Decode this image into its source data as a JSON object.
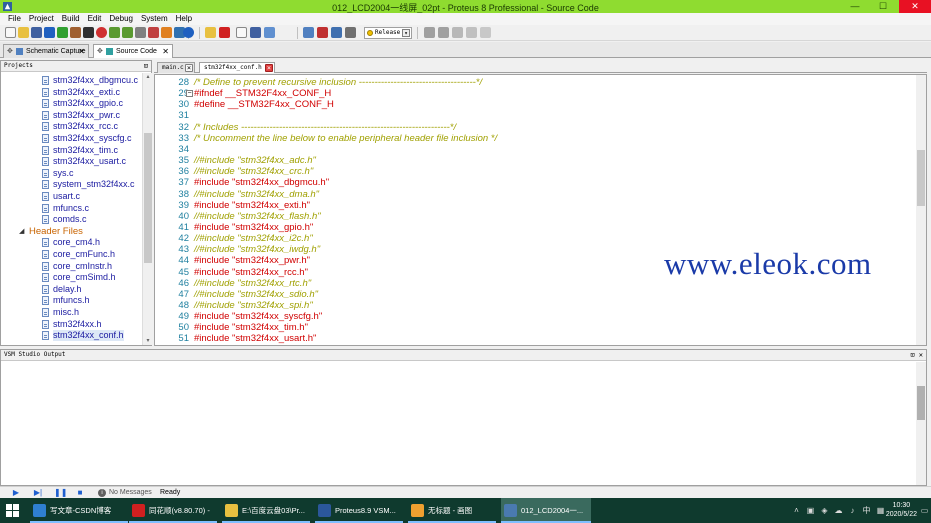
{
  "window": {
    "title": "012_LCD2004一线屏_02pt - Proteus 8 Professional - Source Code",
    "minimize": "—",
    "maximize": "☐",
    "close": "✕"
  },
  "menu": [
    "File",
    "Project",
    "Build",
    "Edit",
    "Debug",
    "System",
    "Help"
  ],
  "toolbar": {
    "build_config": "Release"
  },
  "main_tabs": [
    {
      "label": "Schematic Capture",
      "active": false
    },
    {
      "label": "Source Code",
      "active": true
    }
  ],
  "projects_panel": {
    "title": "Projects",
    "source_files": [
      "stm32f4xx_dbgmcu.c",
      "stm32f4xx_exti.c",
      "stm32f4xx_gpio.c",
      "stm32f4xx_pwr.c",
      "stm32f4xx_rcc.c",
      "stm32f4xx_syscfg.c",
      "stm32f4xx_tim.c",
      "stm32f4xx_usart.c",
      "sys.c",
      "system_stm32f4xx.c",
      "usart.c",
      "mfuncs.c",
      "comds.c"
    ],
    "header_folder": "Header Files",
    "header_files": [
      "core_cm4.h",
      "core_cmFunc.h",
      "core_cmInstr.h",
      "core_cmSimd.h",
      "delay.h",
      "mfuncs.h",
      "misc.h",
      "stm32f4xx.h",
      "stm32f4xx_conf.h"
    ]
  },
  "editor_tabs": [
    {
      "label": "main.c",
      "active": false
    },
    {
      "label": "stm32f4xx_conf.h",
      "active": true
    }
  ],
  "code_lines": [
    {
      "n": "28",
      "text": "/* Define to prevent recursive inclusion -------------------------------------*/",
      "kind": "com",
      "fold": ""
    },
    {
      "n": "29",
      "text": "#ifndef __STM32F4xx_CONF_H",
      "kind": "pp",
      "fold": "−"
    },
    {
      "n": "30",
      "text": "#define __STM32F4xx_CONF_H",
      "kind": "pp",
      "fold": ""
    },
    {
      "n": "31",
      "text": "",
      "kind": "com",
      "fold": ""
    },
    {
      "n": "32",
      "text": "/* Includes ------------------------------------------------------------------*/",
      "kind": "com",
      "fold": ""
    },
    {
      "n": "33",
      "text": "/* Uncomment the line below to enable peripheral header file inclusion */",
      "kind": "com",
      "fold": ""
    },
    {
      "n": "34",
      "text": "",
      "kind": "com",
      "fold": ""
    },
    {
      "n": "35",
      "text": "//#include \"stm32f4xx_adc.h\"",
      "kind": "com",
      "fold": ""
    },
    {
      "n": "36",
      "text": "//#include \"stm32f4xx_crc.h\"",
      "kind": "com",
      "fold": ""
    },
    {
      "n": "37",
      "text": "#include \"stm32f4xx_dbgmcu.h\"",
      "kind": "pp",
      "fold": ""
    },
    {
      "n": "38",
      "text": "//#include \"stm32f4xx_dma.h\"",
      "kind": "com",
      "fold": ""
    },
    {
      "n": "39",
      "text": "#include \"stm32f4xx_exti.h\"",
      "kind": "pp",
      "fold": ""
    },
    {
      "n": "40",
      "text": "//#include \"stm32f4xx_flash.h\"",
      "kind": "com",
      "fold": ""
    },
    {
      "n": "41",
      "text": "#include \"stm32f4xx_gpio.h\"",
      "kind": "pp",
      "fold": ""
    },
    {
      "n": "42",
      "text": "//#include \"stm32f4xx_i2c.h\"",
      "kind": "com",
      "fold": ""
    },
    {
      "n": "43",
      "text": "//#include \"stm32f4xx_iwdg.h\"",
      "kind": "com",
      "fold": ""
    },
    {
      "n": "44",
      "text": "#include \"stm32f4xx_pwr.h\"",
      "kind": "pp",
      "fold": ""
    },
    {
      "n": "45",
      "text": "#include \"stm32f4xx_rcc.h\"",
      "kind": "pp",
      "fold": ""
    },
    {
      "n": "46",
      "text": "//#include \"stm32f4xx_rtc.h\"",
      "kind": "com",
      "fold": ""
    },
    {
      "n": "47",
      "text": "//#include \"stm32f4xx_sdio.h\"",
      "kind": "com",
      "fold": ""
    },
    {
      "n": "48",
      "text": "//#include \"stm32f4xx_spi.h\"",
      "kind": "com",
      "fold": ""
    },
    {
      "n": "49",
      "text": "#include \"stm32f4xx_syscfg.h\"",
      "kind": "pp",
      "fold": ""
    },
    {
      "n": "50",
      "text": "#include \"stm32f4xx_tim.h\"",
      "kind": "pp",
      "fold": ""
    },
    {
      "n": "51",
      "text": "#include \"stm32f4xx_usart.h\"",
      "kind": "pp",
      "fold": ""
    }
  ],
  "watermark": "www.eleok.com",
  "output_panel": {
    "title": "VSM Studio Output"
  },
  "status": {
    "messages": "No Messages",
    "ready": "Ready"
  },
  "taskbar": {
    "items": [
      {
        "label": "写文章-CSDN博客",
        "icon": "browser-icon",
        "color": "#2f7fd0",
        "active": false
      },
      {
        "label": "同花顺(v8.80.70) -",
        "icon": "stock-app-icon",
        "color": "#d02020",
        "active": false
      },
      {
        "label": "E:\\百度云盘03\\Pr...",
        "icon": "folder-icon",
        "color": "#e8c040",
        "active": false
      },
      {
        "label": "Proteus8.9 VSM...",
        "icon": "word-icon",
        "color": "#2b579a",
        "active": false
      },
      {
        "label": "无标题 - 画图",
        "icon": "paint-icon",
        "color": "#f0a030",
        "active": false
      },
      {
        "label": "012_LCD2004一...",
        "icon": "proteus-icon",
        "color": "#4a7ab0",
        "active": true
      }
    ],
    "ime": "中",
    "time": "10:30",
    "date": "2020/5/22"
  },
  "colors": {
    "titlebar": "#8fdc30",
    "comment": "#a0a000",
    "preprocessor": "#d00000",
    "line_number": "#2080a0",
    "tree_text": "#1a1aa0",
    "folder_text": "#c86400",
    "watermark": "#1a3aa8",
    "taskbar": "#0f3a2e"
  }
}
